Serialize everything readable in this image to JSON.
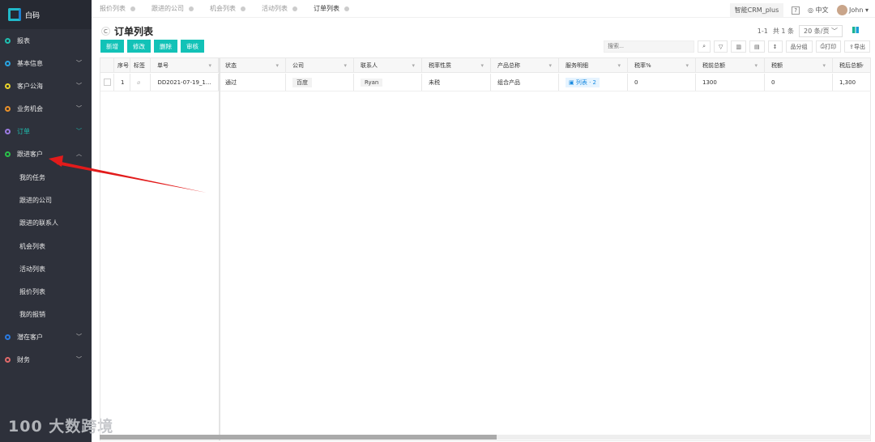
{
  "sidebar": {
    "brand": "白码",
    "items": [
      {
        "label": "报表",
        "color": "#1fbfb0",
        "chevron": ""
      },
      {
        "label": "基本信息",
        "color": "#29a3e0",
        "chevron": "﹀"
      },
      {
        "label": "客户公海",
        "color": "#e8d22a",
        "chevron": "﹀"
      },
      {
        "label": "业务机会",
        "color": "#e8902a",
        "chevron": "﹀"
      },
      {
        "label": "订单",
        "color": "#9a7ae0",
        "chevron": "﹀"
      },
      {
        "label": "跟进客户",
        "color": "#2ac04a",
        "chevron": "︿"
      }
    ],
    "sub_items": [
      "我的任务",
      "跟进的公司",
      "跟进的联系人",
      "机会列表",
      "活动列表",
      "报价列表",
      "我的报销"
    ],
    "bottom_items": [
      {
        "label": "潜在客户",
        "color": "#2a7ae0",
        "chevron": "﹀"
      },
      {
        "label": "财务",
        "color": "#e06a6a",
        "chevron": "﹀"
      }
    ],
    "watermark": "100 大数跨境"
  },
  "tabs": [
    {
      "label": "报价列表"
    },
    {
      "label": "跟进的公司"
    },
    {
      "label": "机会列表"
    },
    {
      "label": "活动列表"
    },
    {
      "label": "订单列表",
      "active": true
    }
  ],
  "header": {
    "app": "智能CRM_plus",
    "help": "?",
    "lang": "中文",
    "user": "John ▾"
  },
  "page": {
    "title": "订单列表",
    "refresh": "C",
    "actions": [
      "新增",
      "修改",
      "删除",
      "审核"
    ],
    "pager": {
      "range": "1-1",
      "total": "共 1 条",
      "page_size": "20 条/页 ﹀"
    },
    "search_placeholder": "搜索...",
    "toolbar": {
      "group": "分组",
      "print": "打印",
      "export": "导出"
    }
  },
  "table": {
    "columns": [
      "",
      "序号",
      "标签",
      "单号",
      "状态",
      "公司",
      "联系人",
      "税率性质",
      "产品总称",
      "服务明细",
      "税率%",
      "税前总额",
      "税额",
      "税后总额"
    ],
    "rows": [
      {
        "index": "1",
        "order_no": "DD2021-07-19_1...",
        "status": "通过",
        "company": "百度",
        "contact": "Ryan",
        "tax_type": "未税",
        "product": "组合产品",
        "service": "列表 · 2",
        "tax_rate": "0",
        "pre_tax": "1300",
        "tax": "0",
        "post_tax": "1,300"
      }
    ]
  }
}
